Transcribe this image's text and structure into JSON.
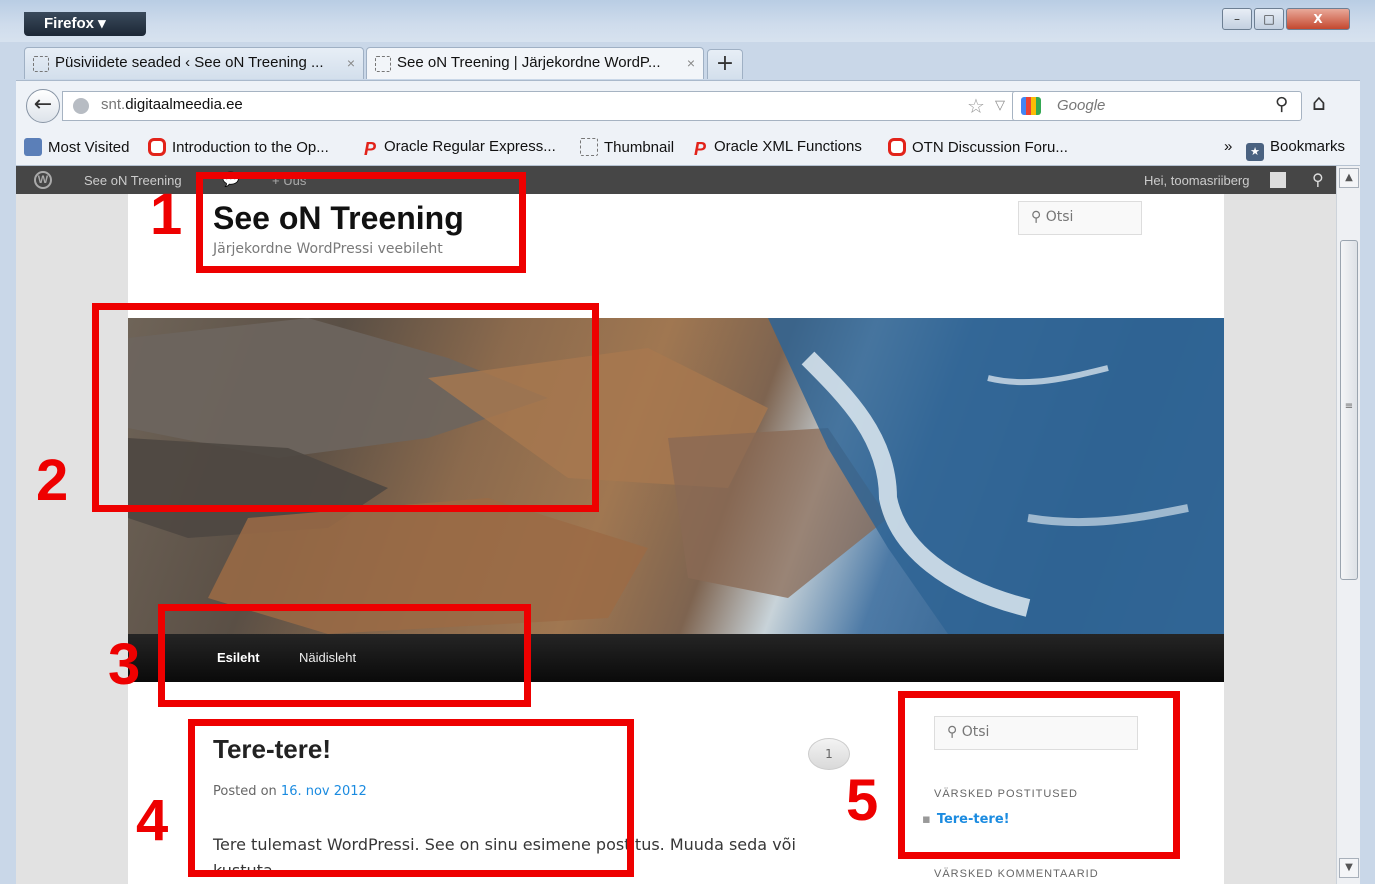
{
  "browser": {
    "menu_label": "Firefox",
    "window_controls": {
      "minimize": "–",
      "maximize": "□",
      "close": "X"
    },
    "tabs": [
      {
        "title": "Püsiviidete seaded ‹ See oN Treening ...",
        "close": "×"
      },
      {
        "title": "See oN Treening | Järjekordne WordP...",
        "close": "×"
      }
    ],
    "new_tab": "+",
    "url_prefix": "snt.",
    "url_domain": "digitaalmeedia.ee",
    "search_placeholder": "Google",
    "bookmarks": [
      {
        "label": "Most Visited",
        "icon": "most-visited-icon"
      },
      {
        "label": "Introduction to the Op...",
        "icon": "oracle-icon"
      },
      {
        "label": "Oracle Regular Express...",
        "icon": "p-icon"
      },
      {
        "label": "Thumbnail",
        "icon": "blank-page-icon"
      },
      {
        "label": "Oracle XML Functions",
        "icon": "p-icon"
      },
      {
        "label": "OTN Discussion Foru...",
        "icon": "oracle-icon"
      }
    ],
    "bookmarks_overflow": "»",
    "bookmarks_menu": "Bookmarks"
  },
  "adminbar": {
    "site_name": "See oN Treening",
    "new_label": "+ Uus",
    "howdy": "Hei, toomasriiberg"
  },
  "site": {
    "title": "See oN Treening",
    "description": "Järjekordne WordPressi veebileht",
    "search_placeholder": "Otsi",
    "menu": [
      "Esileht",
      "Näidisleht"
    ]
  },
  "post": {
    "title": "Tere-tere!",
    "meta_prefix": "Posted on",
    "date": "16. nov 2012",
    "comment_count": "1",
    "content": "Tere tulemast WordPressi. See on sinu esimene postitus. Muuda seda või kustuta"
  },
  "sidebar": {
    "search_placeholder": "Otsi",
    "recent_posts_title": "VÄRSKED POSTITUSED",
    "recent_posts": [
      "Tere-tere!"
    ],
    "recent_comments_title": "VÄRSKED KOMMENTAARID"
  },
  "annotations": [
    "1",
    "2",
    "3",
    "4",
    "5"
  ],
  "colors": {
    "annotation": "#ee0000",
    "link": "#1b8be0",
    "adminbar": "#464646"
  }
}
